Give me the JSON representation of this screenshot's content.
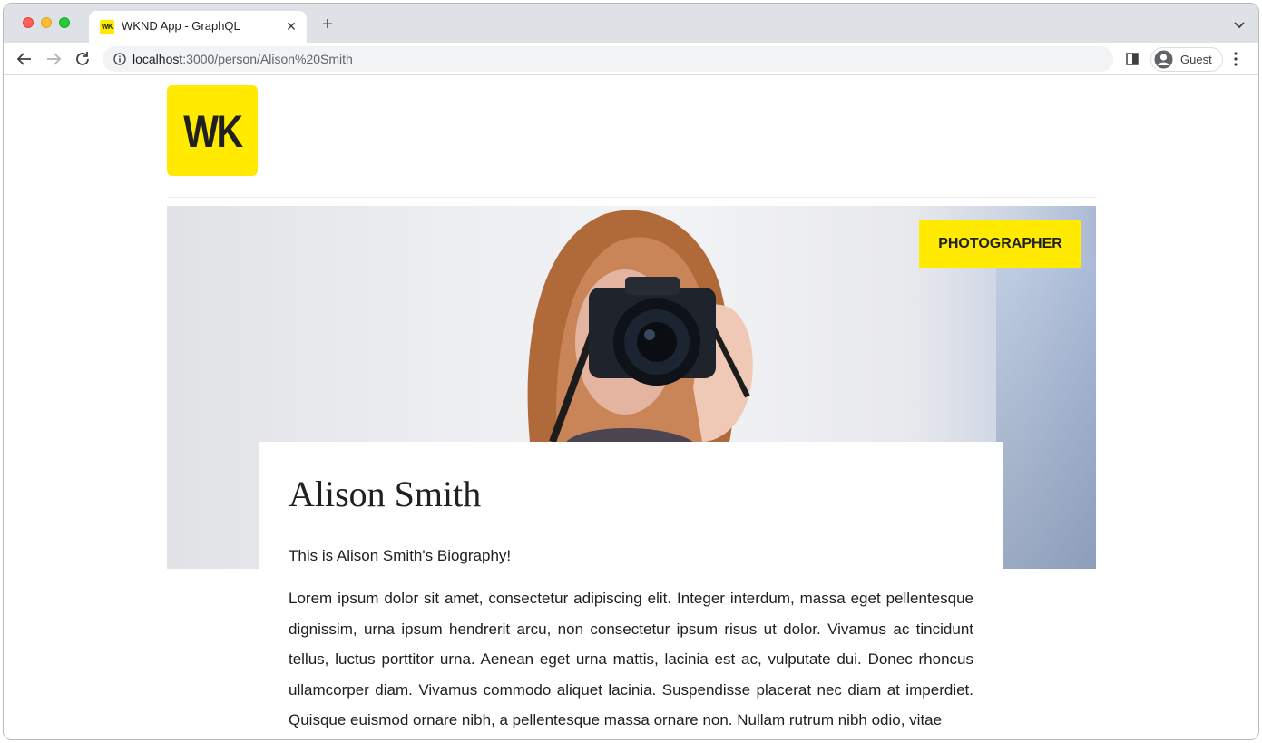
{
  "browser": {
    "tab": {
      "favicon_text": "WK",
      "title": "WKND App - GraphQL"
    },
    "url": {
      "host": "localhost",
      "rest": ":3000/person/Alison%20Smith"
    },
    "profile_label": "Guest"
  },
  "page": {
    "logo_text": "WK",
    "badge": "PHOTOGRAPHER",
    "person": {
      "name": "Alison Smith",
      "bio_intro": "This is Alison Smith's Biography!",
      "bio_body": "Lorem ipsum dolor sit amet, consectetur adipiscing elit. Integer interdum, massa eget pellentesque dignissim, urna ipsum hendrerit arcu, non consectetur ipsum risus ut dolor. Vivamus ac tincidunt tellus, luctus porttitor urna. Aenean eget urna mattis, lacinia est ac, vulputate dui. Donec rhoncus ullamcorper diam. Vivamus commodo aliquet lacinia. Suspendisse placerat nec diam at imperdiet. Quisque euismod ornare nibh, a pellentesque massa ornare non. Nullam rutrum nibh odio, vitae"
    }
  },
  "colors": {
    "brand_yellow": "#ffea00",
    "text_dark": "#202020"
  }
}
